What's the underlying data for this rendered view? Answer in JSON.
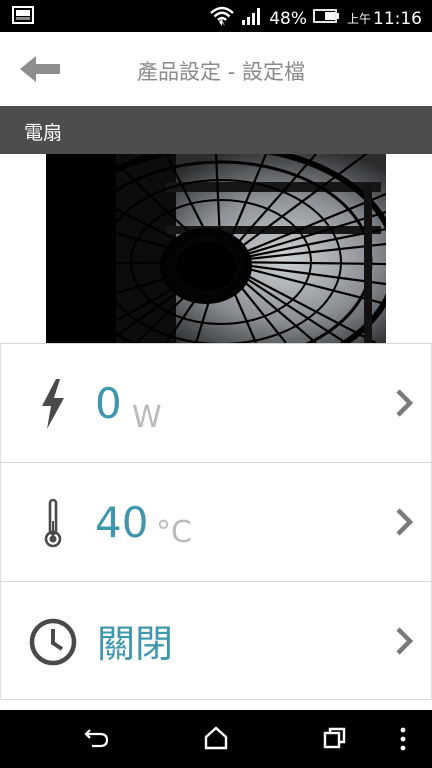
{
  "status_bar": {
    "battery_percent": "48%",
    "ampm": "上午",
    "time": "11:16"
  },
  "app_bar": {
    "title": "產品設定 - 設定檔"
  },
  "device": {
    "name": "電扇"
  },
  "rows": [
    {
      "icon": "lightning-icon",
      "value": "0",
      "unit": "W"
    },
    {
      "icon": "thermometer-icon",
      "value": "40",
      "unit": "°C"
    },
    {
      "icon": "clock-icon",
      "value": "關閉",
      "unit": ""
    }
  ],
  "colors": {
    "accent": "#3f97ad",
    "header_bg": "#4d4d4d",
    "title_gray": "#8a8a8a",
    "unit_gray": "#bbbbbb",
    "icon_gray": "#4a4a4a"
  }
}
